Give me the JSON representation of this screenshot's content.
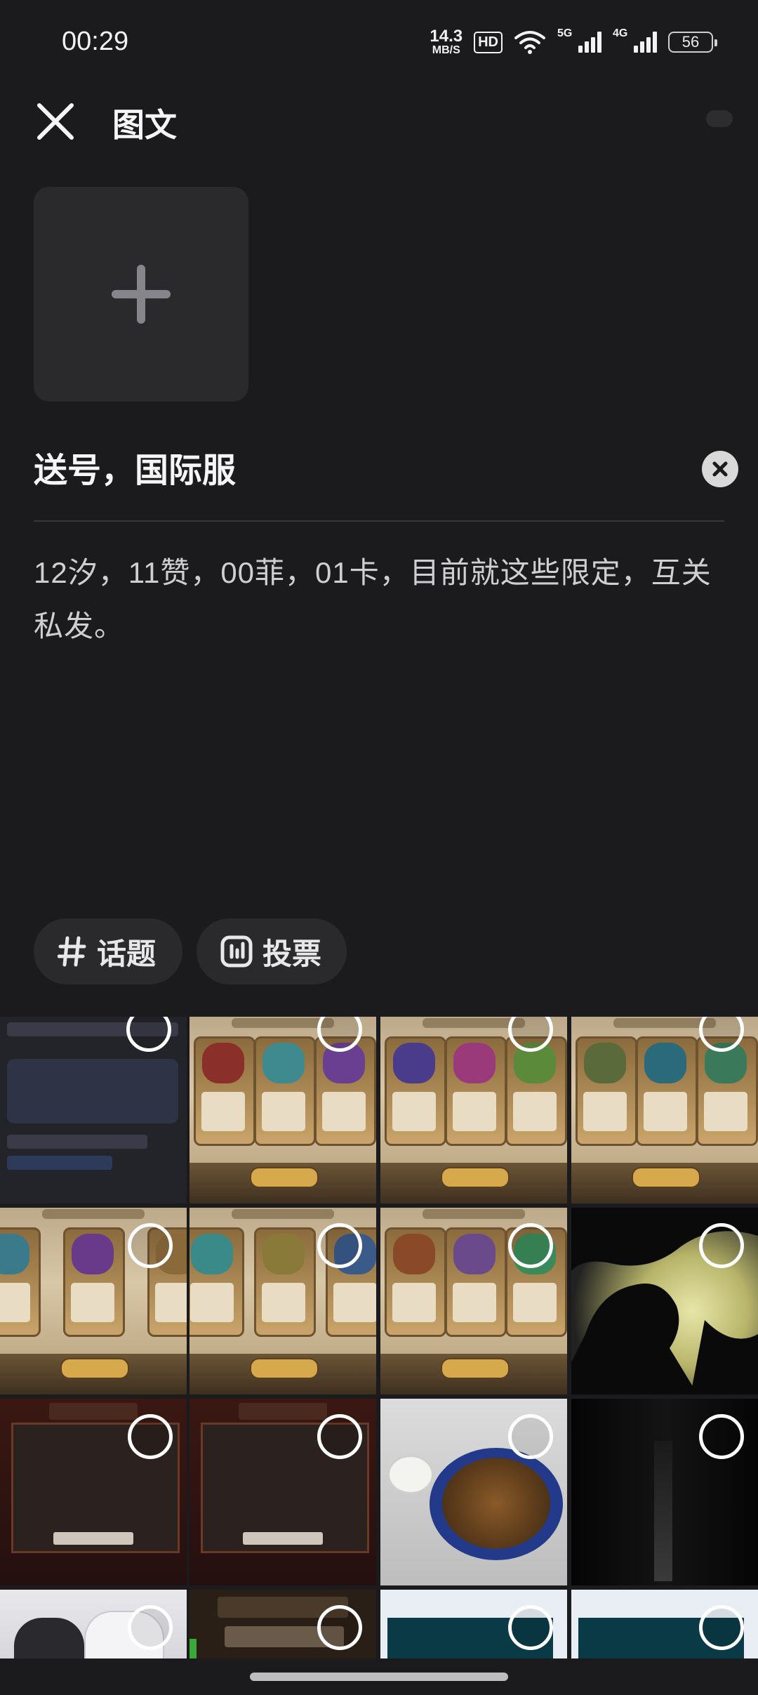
{
  "status_bar": {
    "time": "00:29",
    "net_speed_value": "14.3",
    "net_speed_unit": "MB/S",
    "hd_label": "HD",
    "network_5g_label": "5G",
    "network_4g_label": "4G",
    "battery_level": "56"
  },
  "header": {
    "title": "图文"
  },
  "post": {
    "title": "送号，国际服",
    "body": "12汐，11赞，00菲，01卡，目前就这些限定，互关私发。"
  },
  "chips": {
    "topic_label": "话题",
    "vote_label": "投票"
  },
  "colors": {
    "background": "#1b1b1d",
    "surface": "#2a2a2d",
    "text_primary": "#f5f5f5",
    "text_secondary": "#cfcfd2"
  },
  "icons": {
    "close": "close-icon",
    "add": "plus-icon",
    "clear": "clear-x-icon",
    "topic": "hash-icon",
    "vote": "poll-icon",
    "select": "select-circle-icon"
  }
}
